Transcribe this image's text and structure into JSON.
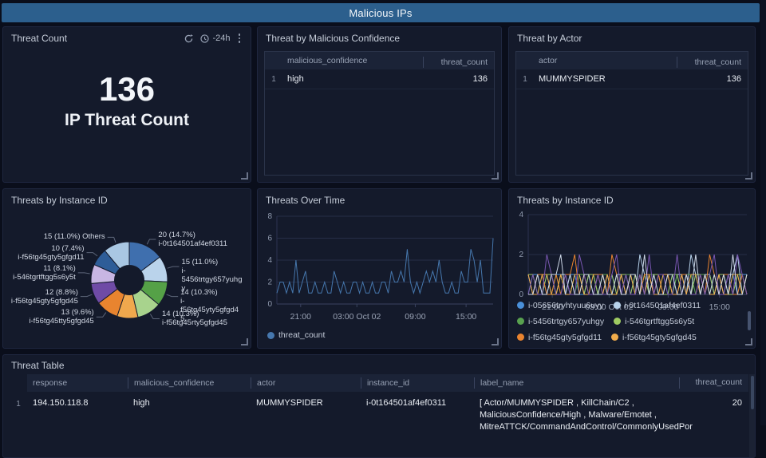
{
  "header": {
    "title": "Malicious IPs"
  },
  "panels": {
    "threat_count": {
      "title": "Threat Count",
      "time_range": "-24h",
      "value": "136",
      "caption": "IP Threat Count"
    },
    "by_confidence": {
      "title": "Threat by Malicious Confidence",
      "columns": [
        "malicious_confidence",
        "threat_count"
      ],
      "rows": [
        {
          "num": "1",
          "cells": [
            "high",
            "136"
          ]
        }
      ]
    },
    "by_actor": {
      "title": "Threat by Actor",
      "columns": [
        "actor",
        "threat_count"
      ],
      "rows": [
        {
          "num": "1",
          "cells": [
            "MUMMYSPIDER",
            "136"
          ]
        }
      ]
    },
    "pie_panel": {
      "title": "Threats by Instance ID"
    },
    "over_time_panel": {
      "title": "Threats Over Time",
      "legend": "threat_count"
    },
    "instance_lines_panel": {
      "title": "Threats by Instance ID"
    },
    "table_panel": {
      "title": "Threat Table",
      "columns": [
        "response",
        "malicious_confidence",
        "actor",
        "instance_id",
        "label_name",
        "threat_count"
      ],
      "rows": [
        {
          "num": "1",
          "response": "194.150.118.8",
          "malicious_confidence": "high",
          "actor": "MUMMYSPIDER",
          "instance_id": "i-0t164501af4ef0311",
          "label_name": "[ Actor/MUMMYSPIDER , KillChain/C2 , MaliciousConfidence/High , Malware/Emotet , MitreATTCK/CommandAndControl/CommonlyUsedPor",
          "threat_count": "20"
        }
      ]
    }
  },
  "chart_data": [
    {
      "type": "pie",
      "title": "Threats by Instance ID",
      "total": 136,
      "slices": [
        {
          "value": 20,
          "color": "#3f6fae",
          "lines": [
            "20 (14.7%)",
            "i-0t164501af4ef0311"
          ]
        },
        {
          "value": 15,
          "color": "#bad3eb",
          "lines": [
            "15 (11.0%)",
            "i-5456trtgy657yuhgy"
          ]
        },
        {
          "value": 14,
          "color": "#55a147",
          "lines": [
            "14 (10.3%)",
            "i-f56tg45yty5gfgd45"
          ]
        },
        {
          "value": 14,
          "color": "#a8d38d",
          "lines": [
            "14 (10.3%)",
            "i-f56tg45rty5gfgd45"
          ]
        },
        {
          "value": 12,
          "color": "#f0a84d",
          "lines": []
        },
        {
          "value": 13,
          "color": "#e8842f",
          "lines": [
            "13 (9.6%)",
            "i-f56tg45tty5gfgd45"
          ]
        },
        {
          "value": 12,
          "color": "#6f4ba6",
          "lines": [
            "12 (8.8%)",
            "i-f56tg45gty5gfgd45"
          ]
        },
        {
          "value": 11,
          "color": "#c8b6e3",
          "lines": [
            "11 (8.1%)",
            "i-546tgrtftgg5s6y5t"
          ]
        },
        {
          "value": 10,
          "color": "#2e5d98",
          "lines": [
            "10 (7.4%)",
            "i-f56tg45gty5gfgd11"
          ]
        },
        {
          "value": 15,
          "color": "#a9c7e3",
          "lines": [
            "15 (11.0%) Others"
          ]
        }
      ]
    },
    {
      "type": "line",
      "title": "Threats Over Time",
      "ylabel": "",
      "xlabel": "",
      "ylim": [
        0,
        8
      ],
      "yticks": [
        0,
        2,
        4,
        6,
        8
      ],
      "xticks": [
        {
          "label": "21:00",
          "f": 0.11
        },
        {
          "label": "03:00 Oct 02",
          "f": 0.37
        },
        {
          "label": "09:00",
          "f": 0.64
        },
        {
          "label": "15:00",
          "f": 0.875
        }
      ],
      "series": [
        {
          "name": "threat_count",
          "color": "#4677ad",
          "values": [
            1,
            2,
            2,
            1,
            2,
            1,
            4,
            1,
            2,
            3,
            1,
            1,
            2,
            1,
            1,
            2,
            1,
            1,
            3,
            2,
            1,
            2,
            1,
            1,
            2,
            2,
            1,
            2,
            1,
            1,
            2,
            1,
            1,
            2,
            2,
            1,
            3,
            2,
            2,
            3,
            2,
            5,
            2,
            1,
            2,
            1,
            2,
            3,
            2,
            3,
            2,
            4,
            2,
            1,
            1,
            2,
            1,
            1,
            3,
            2,
            2,
            5,
            4,
            2,
            4,
            1,
            1,
            1,
            6
          ]
        }
      ]
    },
    {
      "type": "line",
      "title": "Threats by Instance ID",
      "ylim": [
        0,
        4
      ],
      "yticks": [
        0,
        2,
        4
      ],
      "xticks": [
        {
          "label": "21:00",
          "f": 0.11
        },
        {
          "label": "03:00 Oct 02",
          "f": 0.37
        },
        {
          "label": "09:00",
          "f": 0.64
        },
        {
          "label": "15:00",
          "f": 0.875
        }
      ],
      "series": [
        {
          "name": "i-05656tryhtyuu6uyy",
          "color": "#4a90d9",
          "values": [
            0,
            1,
            1,
            0,
            1,
            0,
            1,
            1,
            0,
            1,
            1,
            0,
            0,
            1,
            0,
            1,
            1,
            0,
            1,
            0,
            1,
            1,
            0,
            1,
            0,
            1,
            1,
            0,
            1,
            1,
            0,
            1,
            0,
            1,
            1,
            0,
            1,
            0,
            1,
            1,
            0,
            1,
            1,
            0,
            1,
            0,
            1,
            1
          ]
        },
        {
          "name": "i-0t164501af4ef0311",
          "color": "#b8d3ec",
          "values": [
            1,
            0,
            1,
            1,
            0,
            1,
            0,
            1,
            1,
            0,
            1,
            1,
            0,
            1,
            1,
            0,
            0,
            1,
            0,
            1,
            1,
            0,
            1,
            0,
            2,
            1,
            0,
            1,
            1,
            0,
            1,
            0,
            1,
            1,
            0,
            2,
            1,
            0,
            1,
            1,
            0,
            1,
            0,
            1,
            1,
            2,
            0,
            1
          ]
        },
        {
          "name": "i-5456trtgy657yuhgy",
          "color": "#59a14f",
          "values": [
            0,
            1,
            0,
            1,
            1,
            0,
            1,
            0,
            1,
            1,
            0,
            1,
            1,
            0,
            1,
            0,
            1,
            1,
            0,
            1,
            0,
            1,
            1,
            0,
            1,
            0,
            1,
            1,
            0,
            1,
            1,
            0,
            1,
            0,
            1,
            1,
            0,
            1,
            1,
            0,
            1,
            0,
            1,
            0,
            1,
            1,
            0,
            1
          ]
        },
        {
          "name": "i-546tgrtftgg5s6y5t",
          "color": "#9fcb62",
          "values": [
            1,
            1,
            0,
            0,
            1,
            1,
            0,
            1,
            0,
            0,
            1,
            1,
            0,
            1,
            1,
            0,
            1,
            0,
            1,
            0,
            1,
            1,
            0,
            1,
            0,
            1,
            0,
            1,
            1,
            0,
            0,
            1,
            1,
            0,
            1,
            0,
            1,
            1,
            0,
            1,
            0,
            1,
            1,
            0,
            0,
            1,
            1,
            0
          ]
        },
        {
          "name": "i-f56tg45gty5gfgd11",
          "color": "#e9832f",
          "values": [
            0,
            0,
            1,
            1,
            0,
            0,
            1,
            0,
            1,
            1,
            2,
            0,
            1,
            0,
            0,
            1,
            1,
            0,
            2,
            1,
            0,
            0,
            1,
            1,
            0,
            1,
            1,
            0,
            1,
            0,
            1,
            0,
            0,
            1,
            1,
            0,
            0,
            1,
            0,
            2,
            1,
            0,
            1,
            1,
            0,
            0,
            1,
            0
          ]
        },
        {
          "name": "i-f56tg45gty5gfgd45",
          "color": "#f0ab4b",
          "values": [
            1,
            0,
            0,
            1,
            1,
            0,
            0,
            1,
            0,
            0,
            1,
            1,
            0,
            0,
            1,
            1,
            0,
            1,
            0,
            0,
            1,
            0,
            1,
            0,
            1,
            0,
            1,
            0,
            0,
            1,
            1,
            0,
            0,
            1,
            0,
            1,
            1,
            0,
            1,
            0,
            0,
            1,
            0,
            0,
            1,
            1,
            0,
            1
          ]
        },
        {
          "name": "",
          "color": "#7a57b3",
          "values": [
            0,
            1,
            0,
            0,
            2,
            1,
            0,
            0,
            1,
            0,
            0,
            2,
            1,
            0,
            0,
            1,
            0,
            0,
            1,
            2,
            0,
            1,
            0,
            0,
            1,
            0,
            2,
            0,
            1,
            1,
            0,
            0,
            2,
            0,
            1,
            0,
            0,
            1,
            0,
            1,
            2,
            0,
            0,
            1,
            0,
            2,
            1,
            0
          ]
        },
        {
          "name": "",
          "color": "#cfd9e8",
          "values": [
            0,
            0,
            1,
            0,
            0,
            1,
            1,
            2,
            0,
            1,
            0,
            0,
            1,
            1,
            0,
            0,
            1,
            0,
            0,
            1,
            0,
            0,
            1,
            1,
            0,
            2,
            0,
            1,
            0,
            0,
            1,
            1,
            0,
            0,
            1,
            0,
            2,
            0,
            1,
            0,
            1,
            0,
            1,
            0,
            2,
            0,
            0,
            1
          ]
        }
      ]
    }
  ]
}
